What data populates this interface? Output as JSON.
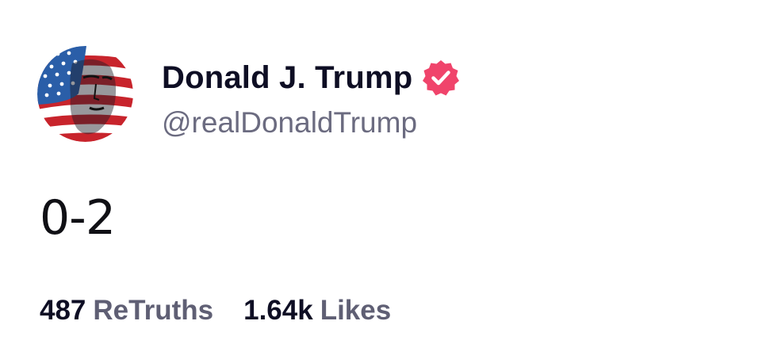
{
  "post": {
    "author": {
      "display_name": "Donald J. Trump",
      "handle": "@realDonaldTrump",
      "verified": true,
      "avatar_icon": "avatar-flag-portrait",
      "badge_icon": "verified-badge-icon"
    },
    "text": "0-2",
    "stats": {
      "retruths_count": "487",
      "retruths_label": "ReTruths",
      "likes_count": "1.64k",
      "likes_label": "Likes"
    }
  },
  "colors": {
    "background": "#ffffff",
    "name_text": "#0e0e24",
    "handle_text": "#6b6b80",
    "stat_label": "#5f5f74",
    "badge": "#f0446b",
    "flag_red": "#c8242c",
    "flag_blue": "#2a5ea8"
  }
}
